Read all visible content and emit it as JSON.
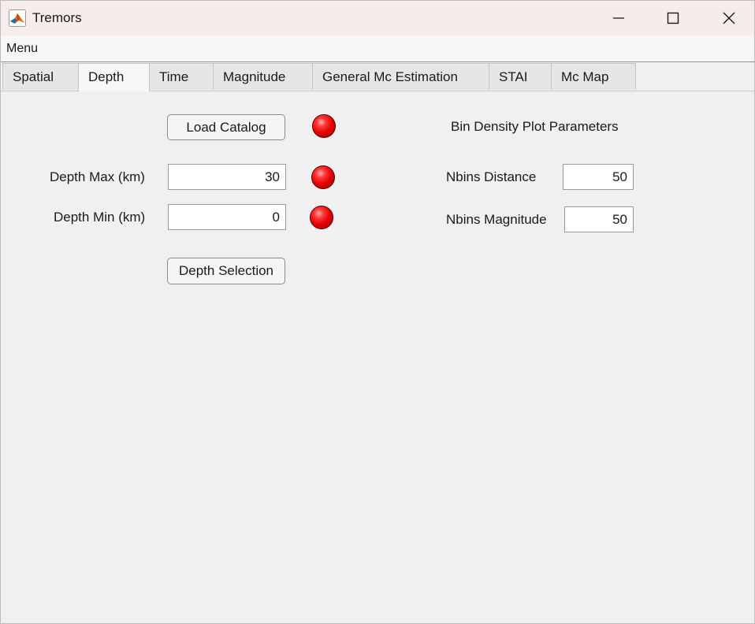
{
  "window": {
    "title": "Tremors",
    "app_icon": "matlab-icon"
  },
  "menubar": {
    "items": [
      {
        "label": "Menu"
      }
    ]
  },
  "tabs": [
    {
      "label": "Spatial",
      "active": false
    },
    {
      "label": "Depth",
      "active": true
    },
    {
      "label": "Time",
      "active": false
    },
    {
      "label": "Magnitude",
      "active": false
    },
    {
      "label": "General Mc Estimation",
      "active": false
    },
    {
      "label": "STAI",
      "active": false
    },
    {
      "label": "Mc Map",
      "active": false
    }
  ],
  "depth_panel": {
    "load_button": "Load Catalog",
    "depth_max_label": "Depth Max (km)",
    "depth_max_value": "30",
    "depth_min_label": "Depth Min (km)",
    "depth_min_value": "0",
    "selection_button": "Depth Selection",
    "lamp_color": "#e00000"
  },
  "bin_density": {
    "heading": "Bin Density Plot Parameters",
    "nbins_distance_label": "Nbins Distance",
    "nbins_distance_value": "50",
    "nbins_magnitude_label": "Nbins Magnitude",
    "nbins_magnitude_value": "50"
  }
}
